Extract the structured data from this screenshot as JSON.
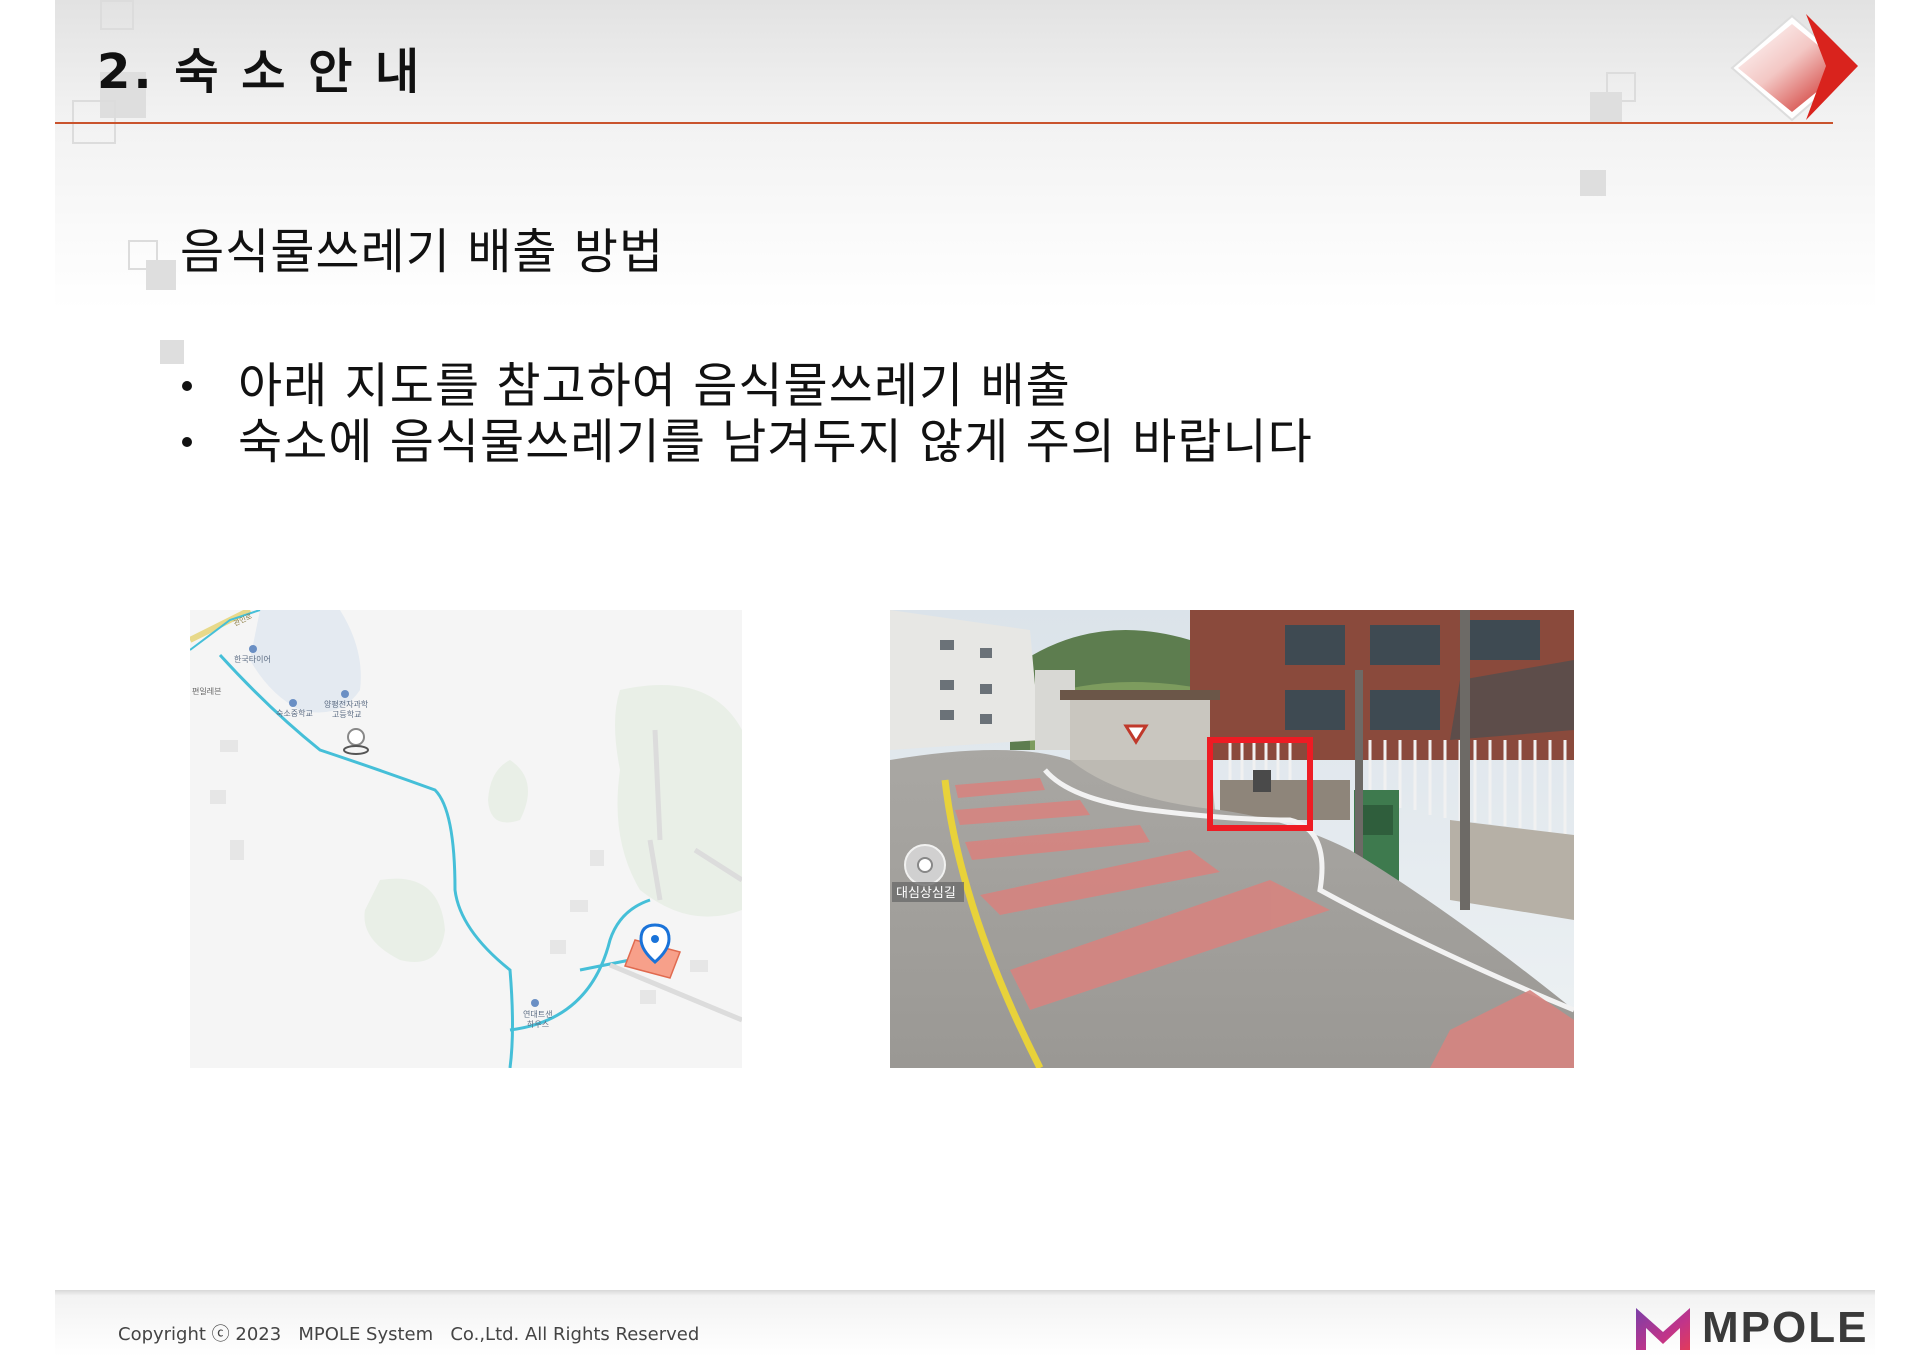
{
  "header": {
    "title": "2. 숙 소 안 내"
  },
  "section": {
    "subtitle": "음식물쓰레기 배출 방법"
  },
  "bullets": [
    {
      "text": "아래 지도를 참고하여 음식물쓰레기 배출"
    },
    {
      "text": "숙소에 음식물쓰레기를 남겨두지 않게 주의 바랍니다"
    }
  ],
  "map": {
    "labels": {
      "road_top": "관인로",
      "poi_tire": "한국타이어",
      "poi_left": "편일레븐",
      "poi_school1": "숙소중학교",
      "poi_school2_line1": "양평전자과학",
      "poi_school2_line2": "고등학교",
      "poi_house_line1": "연대트샌",
      "poi_house_line2": "하우스"
    }
  },
  "photo": {
    "road_label": "대심상심길"
  },
  "footer": {
    "copyright": "Copyright ⓒ 2023   MPOLE System   Co.,Ltd. All Rights Reserved",
    "brand": "MPOLE"
  },
  "colors": {
    "accent": "#c9532d",
    "logo_red": "#d9231d",
    "marker_blue": "#1a73d9",
    "route": "#45bfd8"
  }
}
